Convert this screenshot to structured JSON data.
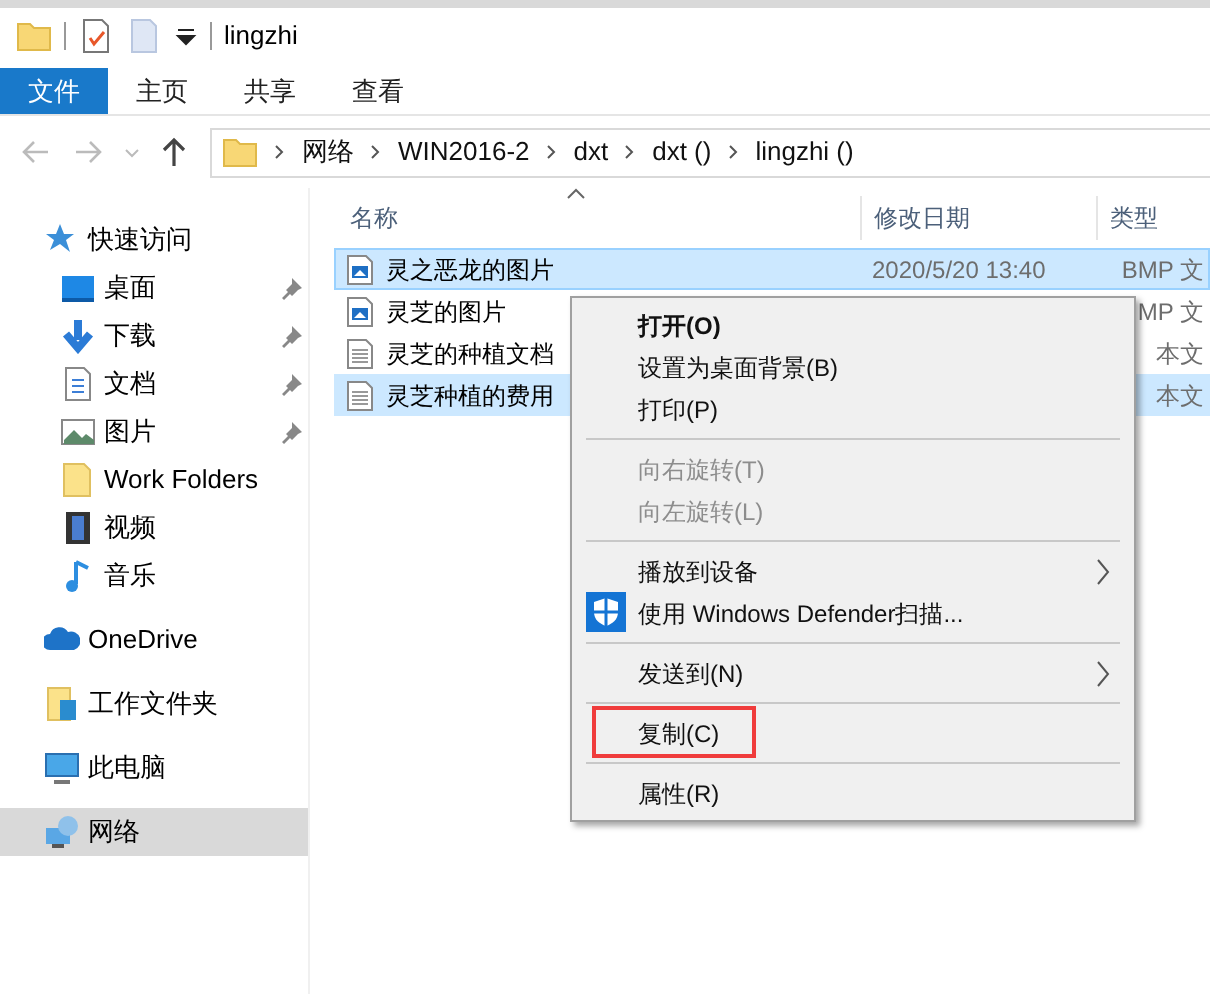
{
  "window": {
    "title": "lingzhi"
  },
  "ribbon_tabs": [
    {
      "label": "文件",
      "selected": true
    },
    {
      "label": "主页",
      "selected": false
    },
    {
      "label": "共享",
      "selected": false
    },
    {
      "label": "查看",
      "selected": false
    }
  ],
  "address_bar": {
    "path": [
      "网络",
      "WIN2016-2",
      "dxt",
      "dxt ()",
      "lingzhi ()"
    ]
  },
  "navigation_pane": {
    "items": [
      {
        "label": "快速访问",
        "selected": false,
        "children": [
          {
            "label": "桌面",
            "pinned": true,
            "selected": false
          },
          {
            "label": "下载",
            "pinned": true,
            "selected": false
          },
          {
            "label": "文档",
            "pinned": true,
            "selected": false
          },
          {
            "label": "图片",
            "pinned": true,
            "selected": false
          },
          {
            "label": "Work Folders",
            "pinned": false,
            "selected": false
          },
          {
            "label": "视频",
            "pinned": false,
            "selected": false
          },
          {
            "label": "音乐",
            "pinned": false,
            "selected": false
          }
        ]
      },
      {
        "label": "OneDrive",
        "selected": false
      },
      {
        "label": "工作文件夹",
        "selected": false
      },
      {
        "label": "此电脑",
        "selected": false
      },
      {
        "label": "网络",
        "selected": true
      }
    ]
  },
  "file_list": {
    "columns": [
      "名称",
      "修改日期",
      "类型"
    ],
    "rows": [
      {
        "kind": "image",
        "name": "灵之恶龙的图片",
        "date": "2020/5/20 13:40",
        "type": "BMP 文",
        "selected": true
      },
      {
        "kind": "image",
        "name": "灵芝的图片",
        "type": "MP 文",
        "selected": false
      },
      {
        "kind": "text",
        "name": "灵芝的种植文档",
        "type": "本文",
        "selected": false
      },
      {
        "kind": "text",
        "name": "灵芝种植的费用",
        "type": "本文",
        "selected": true
      }
    ]
  },
  "context_menu": {
    "groups": [
      [
        {
          "label": "打开(O)",
          "default": true,
          "disabled": false
        },
        {
          "label": "设置为桌面背景(B)",
          "default": false,
          "disabled": false
        },
        {
          "label": "打印(P)",
          "default": false,
          "disabled": false
        }
      ],
      [
        {
          "label": "向右旋转(T)",
          "default": false,
          "disabled": true
        },
        {
          "label": "向左旋转(L)",
          "default": false,
          "disabled": true
        }
      ],
      [
        {
          "label": "播放到设备",
          "default": false,
          "disabled": false,
          "submenu": true
        },
        {
          "label": "使用 Windows Defender扫描...",
          "default": false,
          "disabled": false,
          "icon": true
        }
      ],
      [
        {
          "label": "发送到(N)",
          "default": false,
          "disabled": false,
          "submenu": true
        }
      ],
      [
        {
          "label": "复制(C)",
          "default": false,
          "disabled": false,
          "highlighted": true
        }
      ],
      [
        {
          "label": "属性(R)",
          "default": false,
          "disabled": false
        }
      ]
    ]
  }
}
